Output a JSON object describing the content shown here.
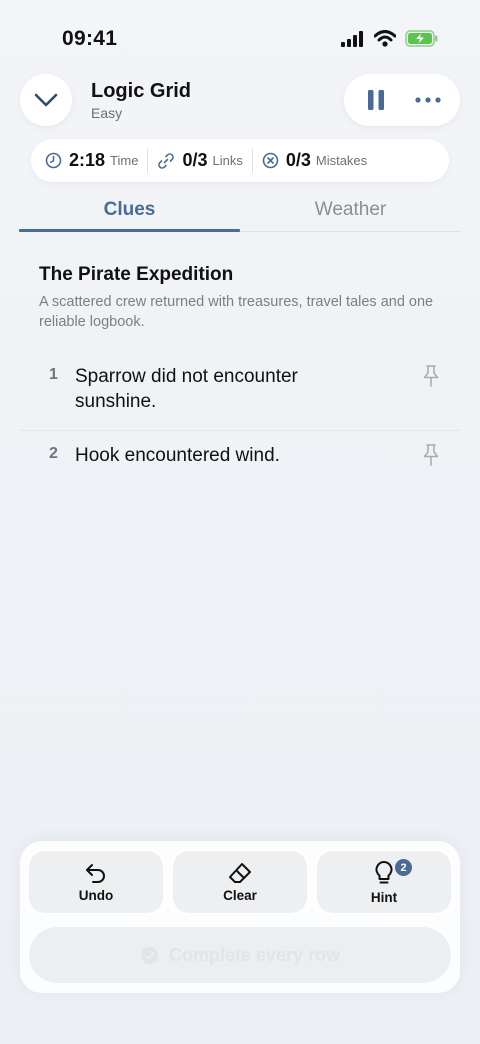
{
  "status_bar": {
    "time": "09:41"
  },
  "header": {
    "title": "Logic Grid",
    "difficulty": "Easy"
  },
  "stats": {
    "time_value": "2:18",
    "time_label": "Time",
    "links_value": "0/3",
    "links_label": "Links",
    "mistakes_value": "0/3",
    "mistakes_label": "Mistakes"
  },
  "tabs": [
    {
      "label": "Clues",
      "active": true
    },
    {
      "label": "Weather",
      "active": false
    }
  ],
  "puzzle": {
    "title": "The Pirate Expedition",
    "description": "A scattered crew returned with treasures, travel tales and one reliable logbook."
  },
  "clues": [
    {
      "number": "1",
      "text": "Sparrow did not encounter sunshine."
    },
    {
      "number": "2",
      "text": "Hook encountered wind."
    }
  ],
  "toolbar": {
    "undo_label": "Undo",
    "clear_label": "Clear",
    "hint_label": "Hint",
    "hint_count": "2",
    "complete_label": "Complete every row"
  },
  "colors": {
    "accent": "#4a6b96",
    "text": "#111111",
    "muted": "#6b6f76"
  }
}
